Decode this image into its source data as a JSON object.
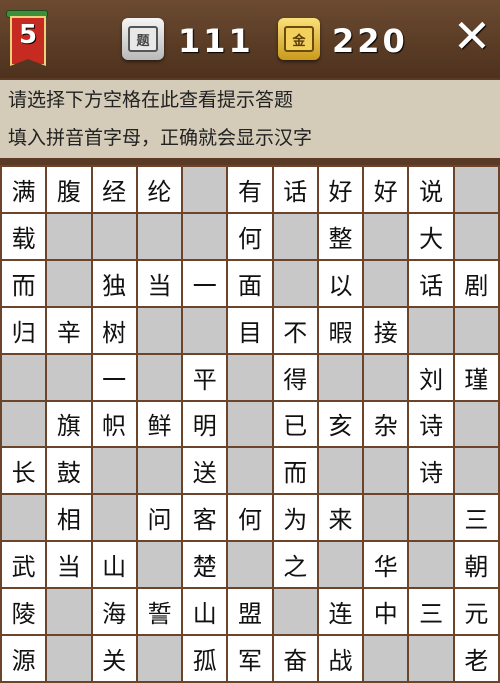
{
  "header": {
    "level": "5",
    "hint_icon_label": "题",
    "hint_count": "111",
    "gold_icon_label": "金",
    "gold_count": "220",
    "close_label": "✕"
  },
  "instructions": {
    "line1": "请选择下方空格在此查看提示答题",
    "line2": "填入拼音首字母，正确就会显示汉字"
  },
  "grid": {
    "rows": [
      [
        "满",
        "腹",
        "经",
        "纶",
        "",
        "有",
        "话",
        "好",
        "好",
        "说",
        ""
      ],
      [
        "载",
        "",
        "",
        "",
        "",
        "何",
        "",
        "整",
        "",
        "大",
        ""
      ],
      [
        "而",
        "",
        "独",
        "当",
        "一",
        "面",
        "",
        "以",
        "",
        "话",
        "剧"
      ],
      [
        "归",
        "辛",
        "树",
        "",
        "",
        "目",
        "不",
        "暇",
        "接",
        "",
        ""
      ],
      [
        "",
        "",
        "一",
        "",
        "平",
        "",
        "得",
        "",
        "",
        "刘",
        "瑾"
      ],
      [
        "",
        "旗",
        "帜",
        "鲜",
        "明",
        "",
        "已",
        "亥",
        "杂",
        "诗",
        ""
      ],
      [
        "长",
        "鼓",
        "",
        "",
        "送",
        "",
        "而",
        "",
        "",
        "诗",
        ""
      ],
      [
        "",
        "相",
        "",
        "问",
        "客",
        "何",
        "为",
        "来",
        "",
        "",
        "三"
      ],
      [
        "武",
        "当",
        "山",
        "",
        "楚",
        "",
        "之",
        "",
        "华",
        "",
        "朝"
      ],
      [
        "陵",
        "",
        "海",
        "誓",
        "山",
        "盟",
        "",
        "连",
        "中",
        "三",
        "元"
      ],
      [
        "源",
        "",
        "关",
        "",
        "孤",
        "军",
        "奋",
        "战",
        "",
        "",
        "老"
      ]
    ]
  }
}
